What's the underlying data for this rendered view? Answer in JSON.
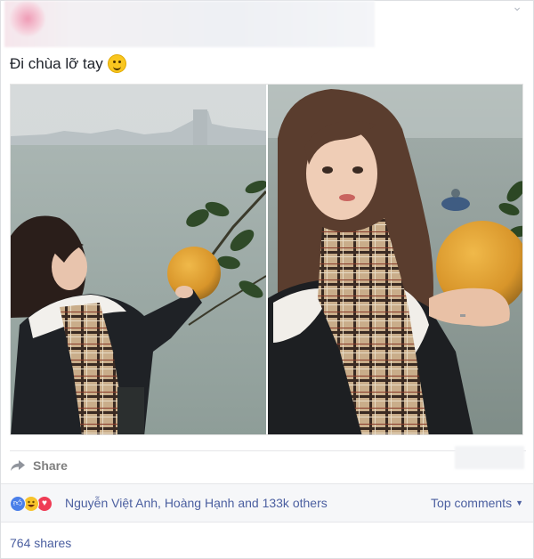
{
  "post": {
    "caption": "Đi chùa lỡ tay",
    "caption_emoji": "smile-emoji",
    "share_label": "Share",
    "reactions": {
      "icons": [
        "like-icon",
        "haha-icon",
        "love-icon"
      ],
      "names_text": "Nguyễn Việt Anh, Hoàng Hạnh and 133k others"
    },
    "top_comments_label": "Top comments",
    "shares_text": "764 shares"
  },
  "colors": {
    "link": "#4b5fa0",
    "like": "#4a7fe9",
    "haha": "#f7c32b",
    "love": "#ef3c55",
    "row_bg": "#f6f7f9"
  }
}
